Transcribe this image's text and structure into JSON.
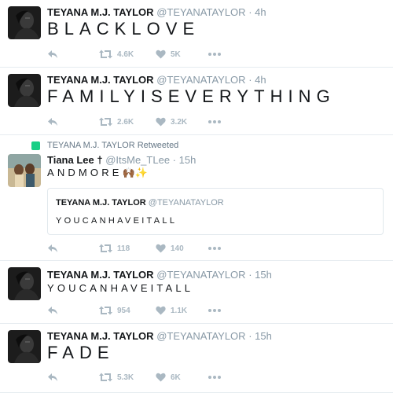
{
  "colors": {
    "retweet_green": "#19cf86",
    "muted": "#aab8c2",
    "handle": "#8899a6",
    "border": "#e6ecf0"
  },
  "icons": {
    "reply": "reply-icon",
    "retweet": "retweet-icon",
    "like": "heart-icon",
    "more": "more-icon"
  },
  "tweets": [
    {
      "name": "TEYANA M.J. TAYLOR",
      "handle": "@TEYANATAYLOR",
      "sep": "·",
      "time": "4h",
      "text": "BLACKLOVE",
      "retweets": "4.6K",
      "likes": "5K"
    },
    {
      "name": "TEYANA M.J. TAYLOR",
      "handle": "@TEYANATAYLOR",
      "sep": "·",
      "time": "4h",
      "text": "FAMILYISEVERYTHING",
      "retweets": "2.6K",
      "likes": "3.2K"
    },
    {
      "retweeted_by": "TEYANA M.J. TAYLOR Retweeted",
      "name": "Tiana Lee †",
      "handle": "@ItsMe_TLee",
      "sep": "·",
      "time": "15h",
      "text": "ANDMORE",
      "emoji": "🙌🏾✨",
      "quote": {
        "name": "TEYANA M.J. TAYLOR",
        "handle": "@TEYANATAYLOR",
        "text": "YOUCANHAVEITALL"
      },
      "retweets": "118",
      "likes": "140"
    },
    {
      "name": "TEYANA M.J. TAYLOR",
      "handle": "@TEYANATAYLOR",
      "sep": "·",
      "time": "15h",
      "text": "YOUCANHAVEITALL",
      "retweets": "954",
      "likes": "1.1K"
    },
    {
      "name": "TEYANA M.J. TAYLOR",
      "handle": "@TEYANATAYLOR",
      "sep": "·",
      "time": "15h",
      "text": "FADE",
      "retweets": "5.3K",
      "likes": "6K"
    }
  ]
}
